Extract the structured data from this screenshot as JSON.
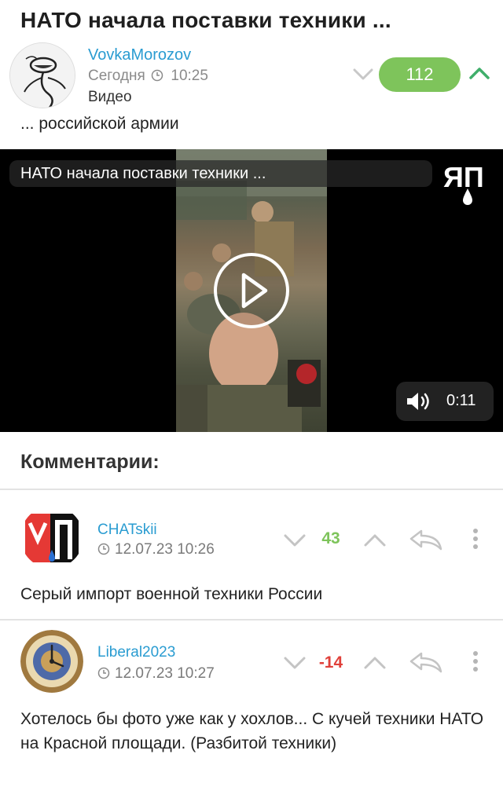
{
  "post": {
    "title": "НАТО начала поставки техники ...",
    "author": "VovkaMorozov",
    "date": "Сегодня",
    "time": "10:25",
    "category": "Видео",
    "score": "112",
    "description": "... российской армии",
    "score_color": "#7ec45b"
  },
  "video": {
    "title": "НАТО начала поставки техники ...",
    "logo_text": "ЯП",
    "duration": "0:11",
    "icons": [
      "play-icon",
      "volume-icon"
    ]
  },
  "comments_heading": "Комментарии:",
  "comments": [
    {
      "author": "CHATskii",
      "datetime": "12.07.23 10:26",
      "score": "43",
      "score_color": "#7ec45b",
      "text": "Серый импорт военной техники России"
    },
    {
      "author": "Liberal2023",
      "datetime": "12.07.23 10:27",
      "score": "-14",
      "score_color": "#e0403a",
      "text": "Хотелось бы фото уже как у хохлов... С кучей техники НАТО на Красной площади. (Разбитой техники)"
    }
  ],
  "colors": {
    "link": "#2a9cd1",
    "positive": "#7ec45b",
    "negative": "#e0403a"
  }
}
